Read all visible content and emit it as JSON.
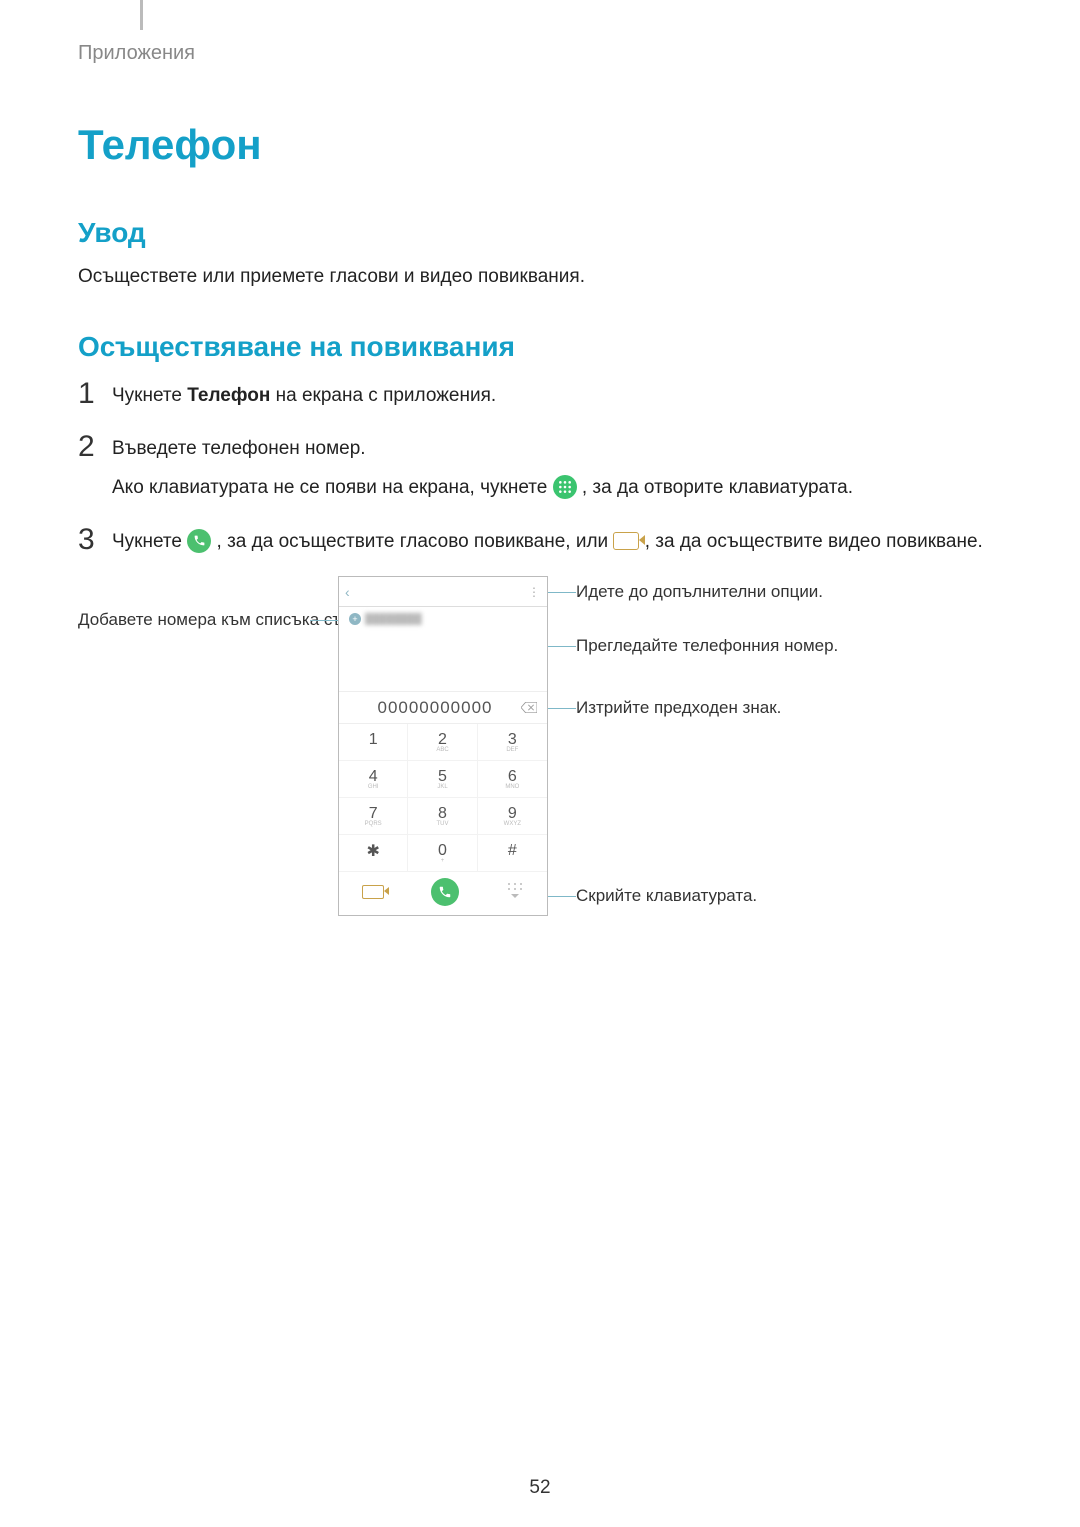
{
  "breadcrumb": "Приложения",
  "title": "Телефон",
  "section_intro": {
    "heading": "Увод",
    "text": "Осъществете или приемете гласови и видео повиквания."
  },
  "section_calls": {
    "heading": "Осъществяване на повиквания",
    "steps": {
      "s1_pre": "Чукнете ",
      "s1_bold": "Телефон",
      "s1_post": " на екрана с приложения.",
      "s2_a": "Въведете телефонен номер.",
      "s2_b_pre": "Ако клавиатурата не се появи на екрана, чукнете ",
      "s2_b_post": ", за да отворите клавиатурата.",
      "s3_pre": "Чукнете ",
      "s3_mid": ", за да осъществите гласово повикване, или ",
      "s3_post": ", за да осъществите видео повикване."
    }
  },
  "diagram": {
    "phone_number": "00000000000",
    "keys": [
      "1",
      "2",
      "3",
      "4",
      "5",
      "6",
      "7",
      "8",
      "9",
      "✱",
      "0",
      "#"
    ],
    "anno_left_add": "Добавете номера към списъка със записи.",
    "anno_right_more": "Идете до допълнителни опции.",
    "anno_right_contact": "Прегледайте телефонния номер.",
    "anno_right_delete": "Изтрийте предходен знак.",
    "anno_right_hidekb": "Скрийте клавиатурата."
  },
  "page_number": "52"
}
